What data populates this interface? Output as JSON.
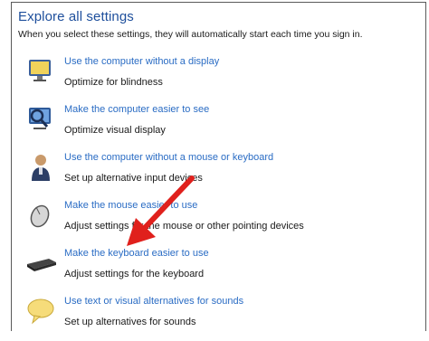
{
  "header": {
    "title": "Explore all settings",
    "subtitle": "When you select these settings, they will automatically start each time you sign in."
  },
  "items": [
    {
      "link": "Use the computer without a display",
      "desc": "Optimize for blindness",
      "icon": "monitor-icon"
    },
    {
      "link": "Make the computer easier to see",
      "desc": "Optimize visual display",
      "icon": "magnifier-monitor-icon"
    },
    {
      "link": "Use the computer without a mouse or keyboard",
      "desc": "Set up alternative input devices",
      "icon": "person-icon"
    },
    {
      "link": "Make the mouse easier to use",
      "desc": "Adjust settings for the mouse or other pointing devices",
      "icon": "mouse-icon"
    },
    {
      "link": "Make the keyboard easier to use",
      "desc": "Adjust settings for the keyboard",
      "icon": "keyboard-icon"
    },
    {
      "link": "Use text or visual alternatives for sounds",
      "desc": "Set up alternatives for sounds",
      "icon": "speech-bubble-icon"
    }
  ],
  "colors": {
    "link": "#2a6cc4",
    "title": "#1e4f9c",
    "annotation_arrow": "#e0201c"
  }
}
